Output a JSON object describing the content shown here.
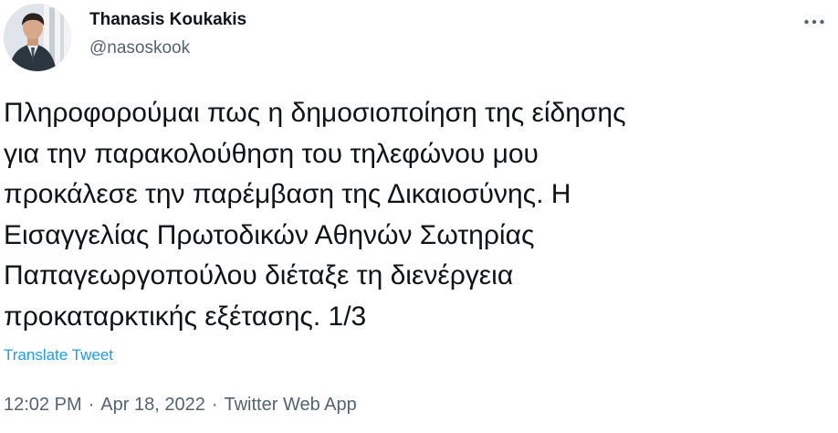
{
  "author": {
    "display_name": "Thanasis Koukakis",
    "handle": "@nasoskook"
  },
  "header": {
    "more_icon": "more-horizontal-icon"
  },
  "tweet": {
    "lines": [
      "Πληροφορούμαι πως η δημοσιοποίηση της είδησης",
      "για την παρακολούθηση του τηλεφώνου μου",
      "προκάλεσε την παρέμβαση της Δικαιοσύνης. Η",
      "Εισαγγελίας Πρωτοδικών Αθηνών Σωτηρίας",
      "Παπαγεωργοπούλου διέταξε τη διενέργεια",
      "προκαταρκτικής εξέτασης. 1/3"
    ],
    "translate_label": "Translate Tweet"
  },
  "meta": {
    "time": "12:02 PM",
    "date": "Apr 18, 2022",
    "source": "Twitter Web App",
    "separator": "·"
  },
  "colors": {
    "text": "#0f1419",
    "secondary": "#536471",
    "link": "#1d9bf0"
  }
}
